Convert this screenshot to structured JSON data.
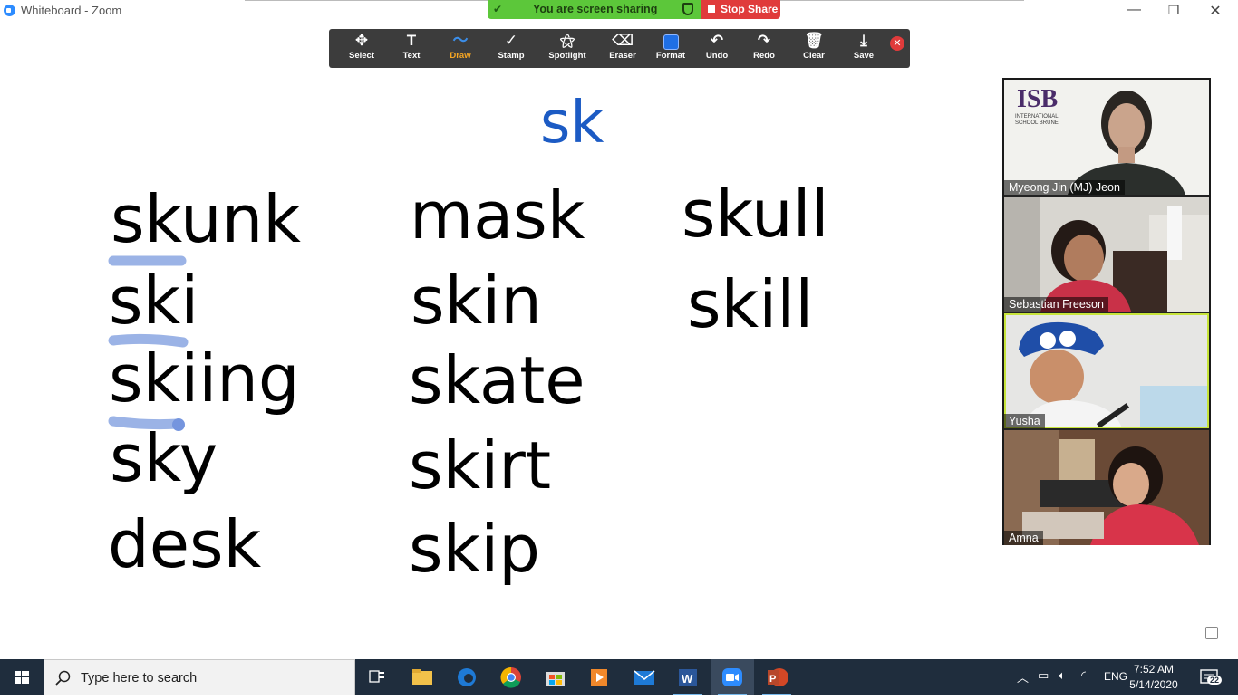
{
  "window": {
    "title": "Whiteboard - Zoom",
    "minimize": "—",
    "restore": "❐",
    "close": "✕"
  },
  "share_banner": {
    "status": "You are screen sharing",
    "stop_label": "Stop Share"
  },
  "toolbar": {
    "tools": [
      {
        "label": "Select",
        "icon": "move-icon",
        "glyph": "✥"
      },
      {
        "label": "Text",
        "icon": "text-icon",
        "glyph": "T"
      },
      {
        "label": "Draw",
        "icon": "draw-icon",
        "glyph": "〜"
      },
      {
        "label": "Stamp",
        "icon": "checkmark-icon",
        "glyph": "✓"
      },
      {
        "label": "Spotlight",
        "icon": "wand-icon",
        "glyph": "⚝"
      },
      {
        "label": "Eraser",
        "icon": "eraser-icon",
        "glyph": "⌫"
      },
      {
        "label": "Format",
        "icon": "format-swatch-icon",
        "glyph": ""
      },
      {
        "label": "Undo",
        "icon": "undo-icon",
        "glyph": "↶"
      },
      {
        "label": "Redo",
        "icon": "redo-icon",
        "glyph": "↷"
      },
      {
        "label": "Clear",
        "icon": "trash-icon",
        "glyph": "🗑"
      },
      {
        "label": "Save",
        "icon": "save-icon",
        "glyph": "⤓"
      }
    ],
    "active_tool": "Draw",
    "format_color": "#1f6fe5",
    "close_glyph": "✕"
  },
  "whiteboard": {
    "heading": "sk",
    "heading_color": "#1c5bc4",
    "highlight_color": "#9bb3e6",
    "column1": [
      "skunk",
      "ski",
      "skiing",
      "sky",
      "desk"
    ],
    "column2": [
      "mask",
      "skin",
      "skate",
      "skirt",
      "skip"
    ],
    "column3": [
      "skull",
      "skill"
    ]
  },
  "participants": [
    {
      "name": "Myeong Jin (MJ) Jeon",
      "school_logo_text": "ISB",
      "school_logo_sub": "INTERNATIONAL SCHOOL BRUNEI"
    },
    {
      "name": "Sebastian Freeson"
    },
    {
      "name": "Yusha"
    },
    {
      "name": "Amna"
    }
  ],
  "taskbar": {
    "search_placeholder": "Type here to search",
    "apps": [
      "task-view",
      "file-explorer",
      "edge",
      "chrome",
      "microsoft-store",
      "video-player",
      "mail",
      "word",
      "zoom",
      "powerpoint"
    ],
    "language": "ENG",
    "time": "7:52 AM",
    "date": "5/14/2020",
    "notifications": "22"
  }
}
